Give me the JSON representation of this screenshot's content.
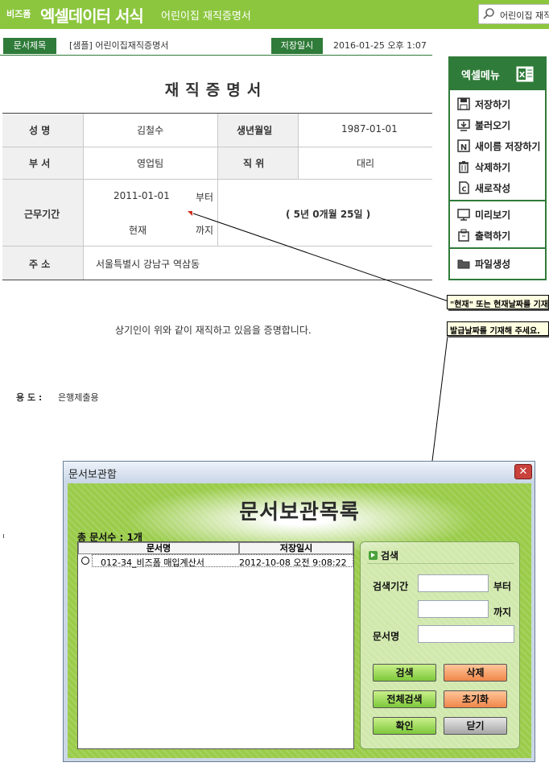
{
  "header": {
    "brand_small": "비즈폼",
    "brand_main": "엑셀데이터 서식",
    "doc_title": "어린이집 재직증명서",
    "search_text": "어린이집 재직"
  },
  "doc_info": {
    "title_label": "문서제목",
    "title_value": "[샘플] 어린이집재직증명서",
    "saved_label": "저장일시",
    "saved_value": "2016-01-25  오후 1:07"
  },
  "certificate": {
    "title": "재직증명서",
    "name_label": "성    명",
    "name_value": "김철수",
    "birth_label": "생년월일",
    "birth_value": "1987-01-01",
    "dept_label": "부    서",
    "dept_value": "영업팀",
    "position_label": "직    위",
    "position_value": "대리",
    "period_label": "근무기간",
    "period_start": "2011-01-01",
    "period_from": "부터",
    "period_end": "현재",
    "period_to": "까지",
    "period_total": "( 5년 0개월 25일 )",
    "address_label": "주    소",
    "address_value": "서울특별시 강남구 역삼동",
    "statement": "상기인이 위와 같이 재직하고 있음을 증명합니다.",
    "purpose_label": "용  도 :",
    "purpose_value": "은행제출용"
  },
  "excel_menu": {
    "title": "엑셀메뉴",
    "items": [
      "저장하기",
      "불러오기",
      "새이름 저장하기",
      "삭제하기",
      "새로작성",
      "미리보기",
      "출력하기",
      "파일생성"
    ]
  },
  "tooltips": {
    "tip1": "\"현재\" 또는 현재날짜를 기재",
    "tip2": "발급날짜를 기재해 주세요."
  },
  "dialog": {
    "window_title": "문서보관함",
    "close_label": "✕",
    "heading": "문서보관목록",
    "doc_count": "총 문서수 : 1개",
    "columns": [
      "문서명",
      "저장일시"
    ],
    "rows": [
      {
        "name": "012-34_비즈폼 매입계산서",
        "saved": "2012-10-08 오전 9:08:22"
      }
    ],
    "search": {
      "title": "검색",
      "period_label": "검색기간",
      "from_label": "부터",
      "to_label": "까지",
      "docname_label": "문서명"
    },
    "buttons": {
      "search": "검색",
      "delete": "삭제",
      "search_all": "전체검색",
      "reset": "초기화",
      "confirm": "확인",
      "close": "닫기"
    }
  },
  "colors": {
    "header_green": "#8cc63f",
    "dark_green": "#2f7b39",
    "dialog_green": "#9acc4a"
  }
}
